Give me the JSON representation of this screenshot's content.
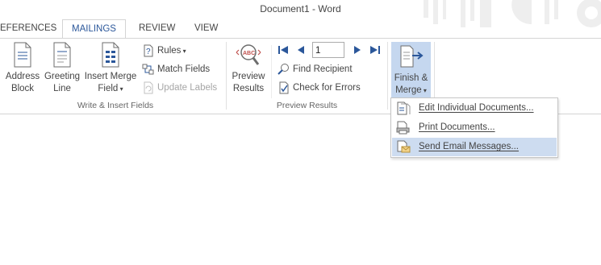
{
  "window": {
    "title": "Document1 - Word"
  },
  "tabs": [
    {
      "label": "EFERENCES"
    },
    {
      "label": "MAILINGS",
      "active": true
    },
    {
      "label": "REVIEW"
    },
    {
      "label": "VIEW"
    }
  ],
  "write_insert": {
    "group_label": "Write & Insert Fields",
    "address_block": [
      "Address",
      "Block"
    ],
    "greeting_line": [
      "Greeting",
      "Line"
    ],
    "insert_merge_field": [
      "Insert Merge",
      "Field"
    ],
    "rules": "Rules",
    "match_fields": "Match Fields",
    "update_labels": "Update Labels"
  },
  "preview": {
    "group_label": "Preview Results",
    "preview_results": [
      "Preview",
      "Results"
    ],
    "record_number": "1",
    "find_recipient": "Find Recipient",
    "check_errors": "Check for Errors"
  },
  "finish": {
    "label": [
      "Finish &",
      "Merge"
    ],
    "menu": [
      {
        "label": "Edit Individual Documents..."
      },
      {
        "label": "Print Documents..."
      },
      {
        "label": "Send Email Messages...",
        "highlighted": true
      }
    ]
  },
  "colors": {
    "accent": "#2b579a",
    "highlight": "#cddcf0",
    "finish_bg": "#c5d7ef"
  }
}
